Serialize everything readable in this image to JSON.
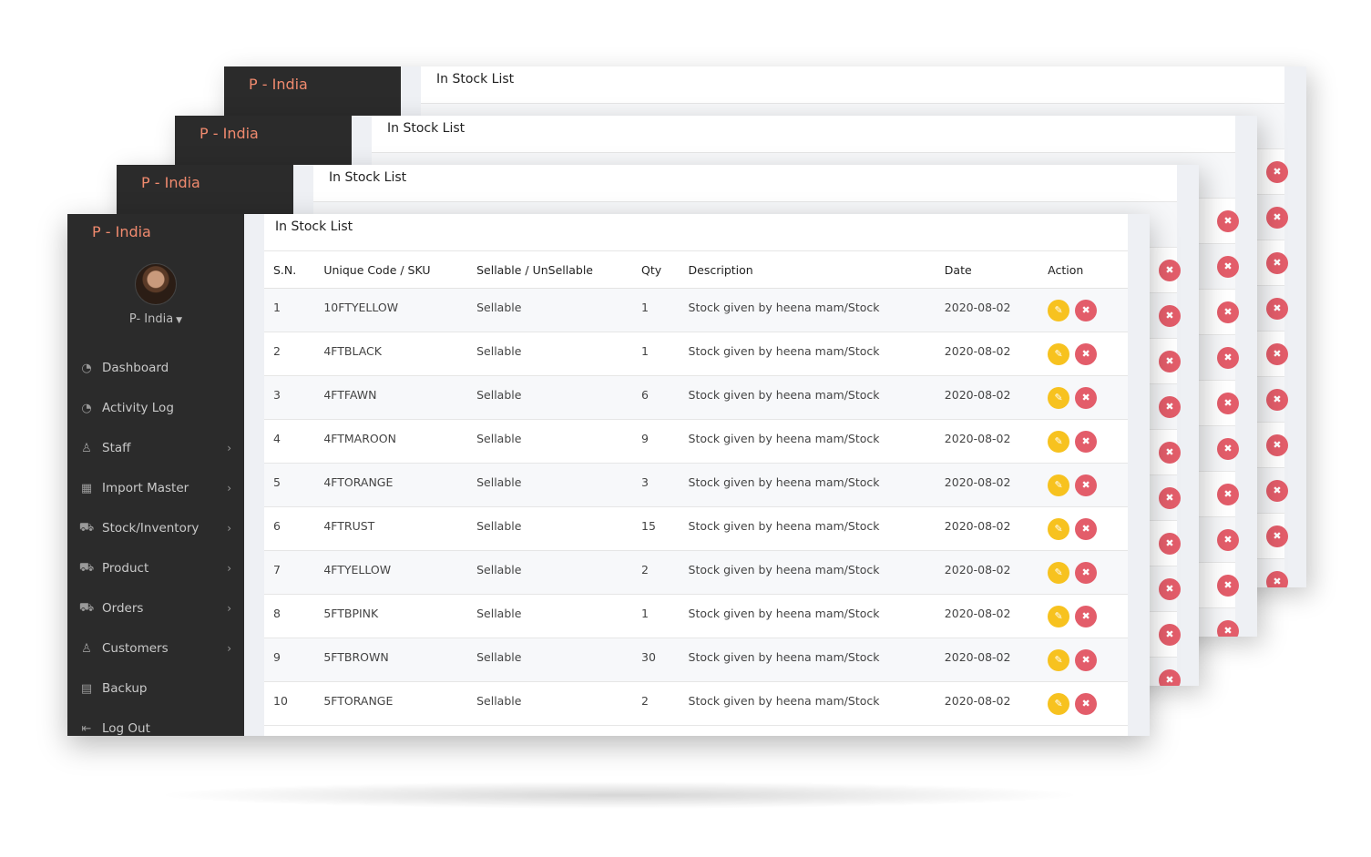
{
  "brand": "P - India",
  "panel_title": "In Stock List",
  "user": {
    "name": "P- India"
  },
  "nav": [
    {
      "label": "Dashboard",
      "icon": "gauge-icon",
      "arrow": false
    },
    {
      "label": "Activity Log",
      "icon": "gauge-icon",
      "arrow": false
    },
    {
      "label": "Staff",
      "icon": "user-icon",
      "arrow": true
    },
    {
      "label": "Import Master",
      "icon": "building-icon",
      "arrow": true
    },
    {
      "label": "Stock/Inventory",
      "icon": "cart-icon",
      "arrow": true
    },
    {
      "label": "Product",
      "icon": "cart-icon",
      "arrow": true
    },
    {
      "label": "Orders",
      "icon": "cart-icon",
      "arrow": true
    },
    {
      "label": "Customers",
      "icon": "user-icon",
      "arrow": true
    },
    {
      "label": "Backup",
      "icon": "database-icon",
      "arrow": false
    },
    {
      "label": "Log Out",
      "icon": "logout-icon",
      "arrow": false
    }
  ],
  "table": {
    "headers": [
      "S.N.",
      "Unique Code / SKU",
      "Sellable / UnSellable",
      "Qty",
      "Description",
      "Date",
      "Action"
    ],
    "rows": [
      {
        "sn": "1",
        "sku": "10FTYELLOW",
        "type": "Sellable",
        "qty": "1",
        "desc": "Stock given by heena mam/Stock",
        "date": "2020-08-02"
      },
      {
        "sn": "2",
        "sku": "4FTBLACK",
        "type": "Sellable",
        "qty": "1",
        "desc": "Stock given by heena mam/Stock",
        "date": "2020-08-02"
      },
      {
        "sn": "3",
        "sku": "4FTFAWN",
        "type": "Sellable",
        "qty": "6",
        "desc": "Stock given by heena mam/Stock",
        "date": "2020-08-02"
      },
      {
        "sn": "4",
        "sku": "4FTMAROON",
        "type": "Sellable",
        "qty": "9",
        "desc": "Stock given by heena mam/Stock",
        "date": "2020-08-02"
      },
      {
        "sn": "5",
        "sku": "4FTORANGE",
        "type": "Sellable",
        "qty": "3",
        "desc": "Stock given by heena mam/Stock",
        "date": "2020-08-02"
      },
      {
        "sn": "6",
        "sku": "4FTRUST",
        "type": "Sellable",
        "qty": "15",
        "desc": "Stock given by heena mam/Stock",
        "date": "2020-08-02"
      },
      {
        "sn": "7",
        "sku": "4FTYELLOW",
        "type": "Sellable",
        "qty": "2",
        "desc": "Stock given by heena mam/Stock",
        "date": "2020-08-02"
      },
      {
        "sn": "8",
        "sku": "5FTBPINK",
        "type": "Sellable",
        "qty": "1",
        "desc": "Stock given by heena mam/Stock",
        "date": "2020-08-02"
      },
      {
        "sn": "9",
        "sku": "5FTBROWN",
        "type": "Sellable",
        "qty": "30",
        "desc": "Stock given by heena mam/Stock",
        "date": "2020-08-02"
      },
      {
        "sn": "10",
        "sku": "5FTORANGE",
        "type": "Sellable",
        "qty": "2",
        "desc": "Stock given by heena mam/Stock",
        "date": "2020-08-02"
      }
    ]
  },
  "colors": {
    "sidebar_bg": "#2b2b2b",
    "brand_accent": "#f08a6e",
    "sku_link": "#f0917a",
    "edit_button": "#f7c21f",
    "delete_button": "#e35d6a"
  }
}
